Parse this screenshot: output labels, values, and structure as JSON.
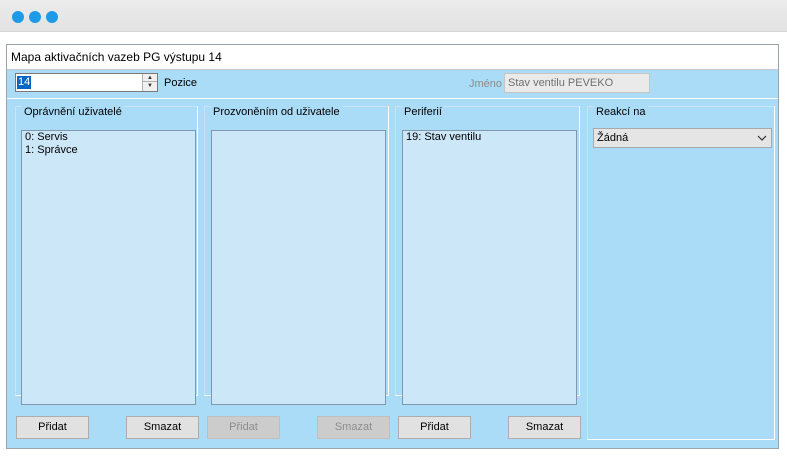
{
  "window": {
    "title": "Mapa aktivačních vazeb PG výstupu 14"
  },
  "toprow": {
    "position_value": "14",
    "position_label": "Pozice",
    "name_label": "Jméno",
    "name_value": "Stav ventilu PEVEKO"
  },
  "groups": {
    "users": {
      "label": "Oprávnění uživatelé",
      "items": [
        "0: Servis",
        "1: Správce"
      ],
      "add_label": "Přidat",
      "delete_label": "Smazat"
    },
    "calls": {
      "label": "Prozvoněním od uživatele",
      "items": [],
      "add_label": "Přidat",
      "delete_label": "Smazat"
    },
    "peripheries": {
      "label": "Periferií",
      "items": [
        "19: Stav ventilu"
      ],
      "add_label": "Přidat",
      "delete_label": "Smazat"
    },
    "reaction": {
      "label": "Reakcí na",
      "selected": "Žádná"
    }
  },
  "colors": {
    "panel_bg": "#abdcf7",
    "listbox_bg": "#cce7f8",
    "traffic_dot": "#1e9be8",
    "selection": "#0a64c8"
  }
}
